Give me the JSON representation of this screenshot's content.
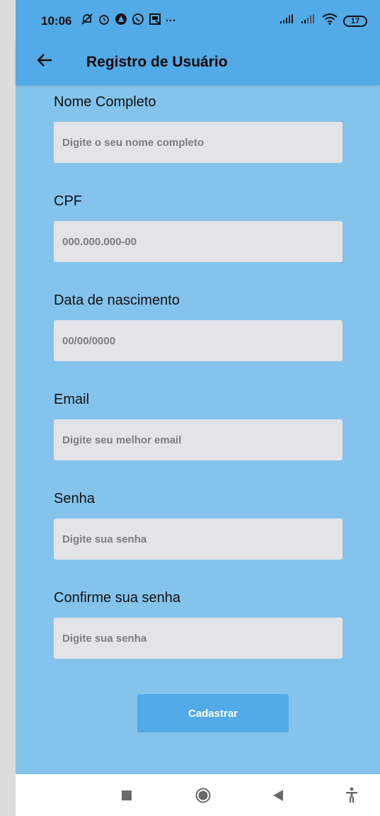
{
  "status_bar": {
    "time": "10:06",
    "left_icons": [
      "alarm-off-icon",
      "alarm-clock-icon",
      "app-notification-icon",
      "whatsapp-icon",
      "picture-icon"
    ],
    "more": "···",
    "battery": "17",
    "right_icons": [
      "signal-icon",
      "signal-weak-icon",
      "wifi-icon",
      "battery-icon"
    ]
  },
  "app_bar": {
    "title": "Registro de Usuário"
  },
  "form": {
    "fields": [
      {
        "label": "Nome Completo",
        "placeholder": "Digite o seu nome completo",
        "value": ""
      },
      {
        "label": "CPF",
        "placeholder": "000.000.000-00",
        "value": ""
      },
      {
        "label": "Data de nascimento",
        "placeholder": "00/00/0000",
        "value": ""
      },
      {
        "label": "Email",
        "placeholder": "Digite seu melhor email",
        "value": ""
      },
      {
        "label": "Senha",
        "placeholder": "Digite sua senha",
        "value": ""
      },
      {
        "label": "Confirme sua senha",
        "placeholder": "Digite sua senha",
        "value": ""
      }
    ],
    "submit_label": "Cadastrar"
  },
  "nav_bar": {
    "buttons": [
      "recents-icon",
      "home-icon",
      "back-icon",
      "accessibility-icon"
    ]
  },
  "colors": {
    "app_bar": "#52aae6",
    "background": "#84c3ec",
    "input_background": "#e3e3e8",
    "button": "#52aae6"
  }
}
